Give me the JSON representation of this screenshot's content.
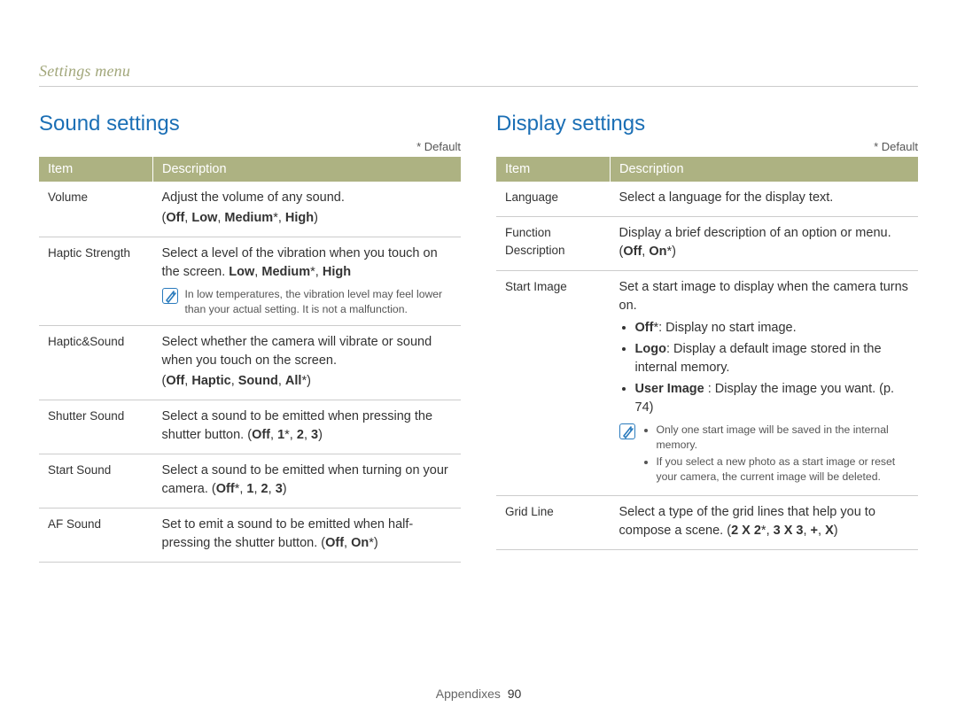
{
  "breadcrumb": "Settings menu",
  "default_note": "* Default",
  "columns": {
    "item_header": "Item",
    "desc_header": "Description"
  },
  "sound": {
    "title": "Sound settings",
    "rows": {
      "volume": {
        "item": "Volume",
        "desc": "Adjust the volume of any sound.",
        "opts_html": "(<b>Off</b>, <b>Low</b>, <b>Medium</b>*, <b>High</b>)"
      },
      "haptic_strength": {
        "item": "Haptic Strength",
        "desc": "Select a level of the vibration when you touch on the screen.",
        "opts_html": "<b>Low</b>, <b>Medium</b>*, <b>High</b>",
        "note": "In low temperatures, the vibration level may feel lower than your actual setting. It is not a malfunction."
      },
      "haptic_sound": {
        "item": "Haptic&Sound",
        "desc": "Select whether the camera will vibrate or sound when you touch on the screen.",
        "opts_html": "(<b>Off</b>, <b>Haptic</b>, <b>Sound</b>, <b>All</b>*)"
      },
      "shutter_sound": {
        "item": "Shutter Sound",
        "desc_html": "Select a sound to be emitted when pressing the shutter button. (<b>Off</b>, <b>1</b>*, <b>2</b>, <b>3</b>)"
      },
      "start_sound": {
        "item": "Start Sound",
        "desc_html": "Select a sound to be emitted when turning on your camera. (<b>Off</b>*, <b>1</b>, <b>2</b>, <b>3</b>)"
      },
      "af_sound": {
        "item": "AF Sound",
        "desc_html": "Set to emit a sound to be emitted when half-pressing the shutter button. (<b>Off</b>, <b>On</b>*)"
      }
    }
  },
  "display": {
    "title": "Display settings",
    "rows": {
      "language": {
        "item": "Language",
        "desc": "Select a language for the display text."
      },
      "function_description": {
        "item": "Function Description",
        "desc_html": "Display a brief description of an option or menu. (<b>Off</b>, <b>On</b>*)"
      },
      "start_image": {
        "item": "Start Image",
        "desc": "Set a start image to display when the camera turns on.",
        "bullets": [
          "<b>Off</b>*: Display no start image.",
          "<b>Logo</b>: Display a default image stored in the internal memory.",
          "<b>User Image</b> : Display the image you want. (p. 74)"
        ],
        "notes": [
          "Only one start image will be saved in the internal memory.",
          "If you select a new photo as a start image or reset your camera, the current image will be deleted."
        ]
      },
      "grid_line": {
        "item": "Grid Line",
        "desc_html": "Select a type of the grid lines that help you to compose a scene. (<b>2 X 2</b>*, <b>3 X 3</b>, <b>+</b>, <b>X</b>)"
      }
    }
  },
  "footer": {
    "label": "Appendixes",
    "page": "90"
  }
}
